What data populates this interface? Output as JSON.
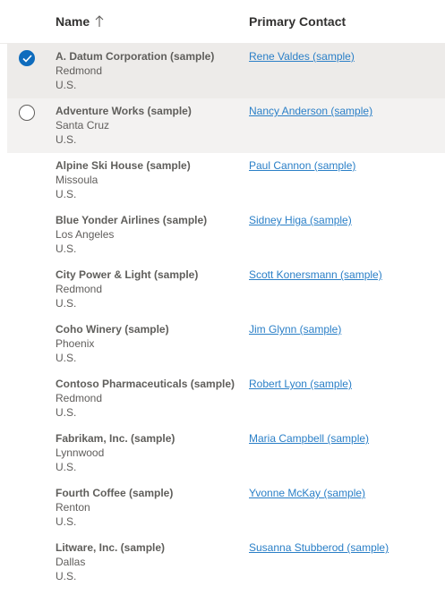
{
  "columns": {
    "name": "Name",
    "contact": "Primary Contact",
    "sort_icon": "arrow-up-icon"
  },
  "rows": [
    {
      "name": "A. Datum Corporation (sample)",
      "city": "Redmond",
      "country": "U.S.",
      "contact": "Rene Valdes (sample)",
      "state": "selected"
    },
    {
      "name": "Adventure Works (sample)",
      "city": "Santa Cruz",
      "country": "U.S.",
      "contact": "Nancy Anderson (sample)",
      "state": "hovered"
    },
    {
      "name": "Alpine Ski House (sample)",
      "city": "Missoula",
      "country": "U.S.",
      "contact": "Paul Cannon (sample)",
      "state": "normal"
    },
    {
      "name": "Blue Yonder Airlines (sample)",
      "city": "Los Angeles",
      "country": "U.S.",
      "contact": "Sidney Higa (sample)",
      "state": "normal"
    },
    {
      "name": "City Power & Light (sample)",
      "city": "Redmond",
      "country": "U.S.",
      "contact": "Scott Konersmann (sample)",
      "state": "normal"
    },
    {
      "name": "Coho Winery (sample)",
      "city": "Phoenix",
      "country": "U.S.",
      "contact": "Jim Glynn (sample)",
      "state": "normal"
    },
    {
      "name": "Contoso Pharmaceuticals (sample)",
      "city": "Redmond",
      "country": "U.S.",
      "contact": "Robert Lyon (sample)",
      "state": "normal"
    },
    {
      "name": "Fabrikam, Inc. (sample)",
      "city": "Lynnwood",
      "country": "U.S.",
      "contact": "Maria Campbell (sample)",
      "state": "normal"
    },
    {
      "name": "Fourth Coffee (sample)",
      "city": "Renton",
      "country": "U.S.",
      "contact": "Yvonne McKay (sample)",
      "state": "normal"
    },
    {
      "name": "Litware, Inc. (sample)",
      "city": "Dallas",
      "country": "U.S.",
      "contact": "Susanna Stubberod (sample)",
      "state": "normal"
    }
  ],
  "colors": {
    "selected_row": "#edebe9",
    "hover_row": "#f3f2f1",
    "link": "#2a7fc7",
    "check_accent": "#0f6cbd"
  }
}
